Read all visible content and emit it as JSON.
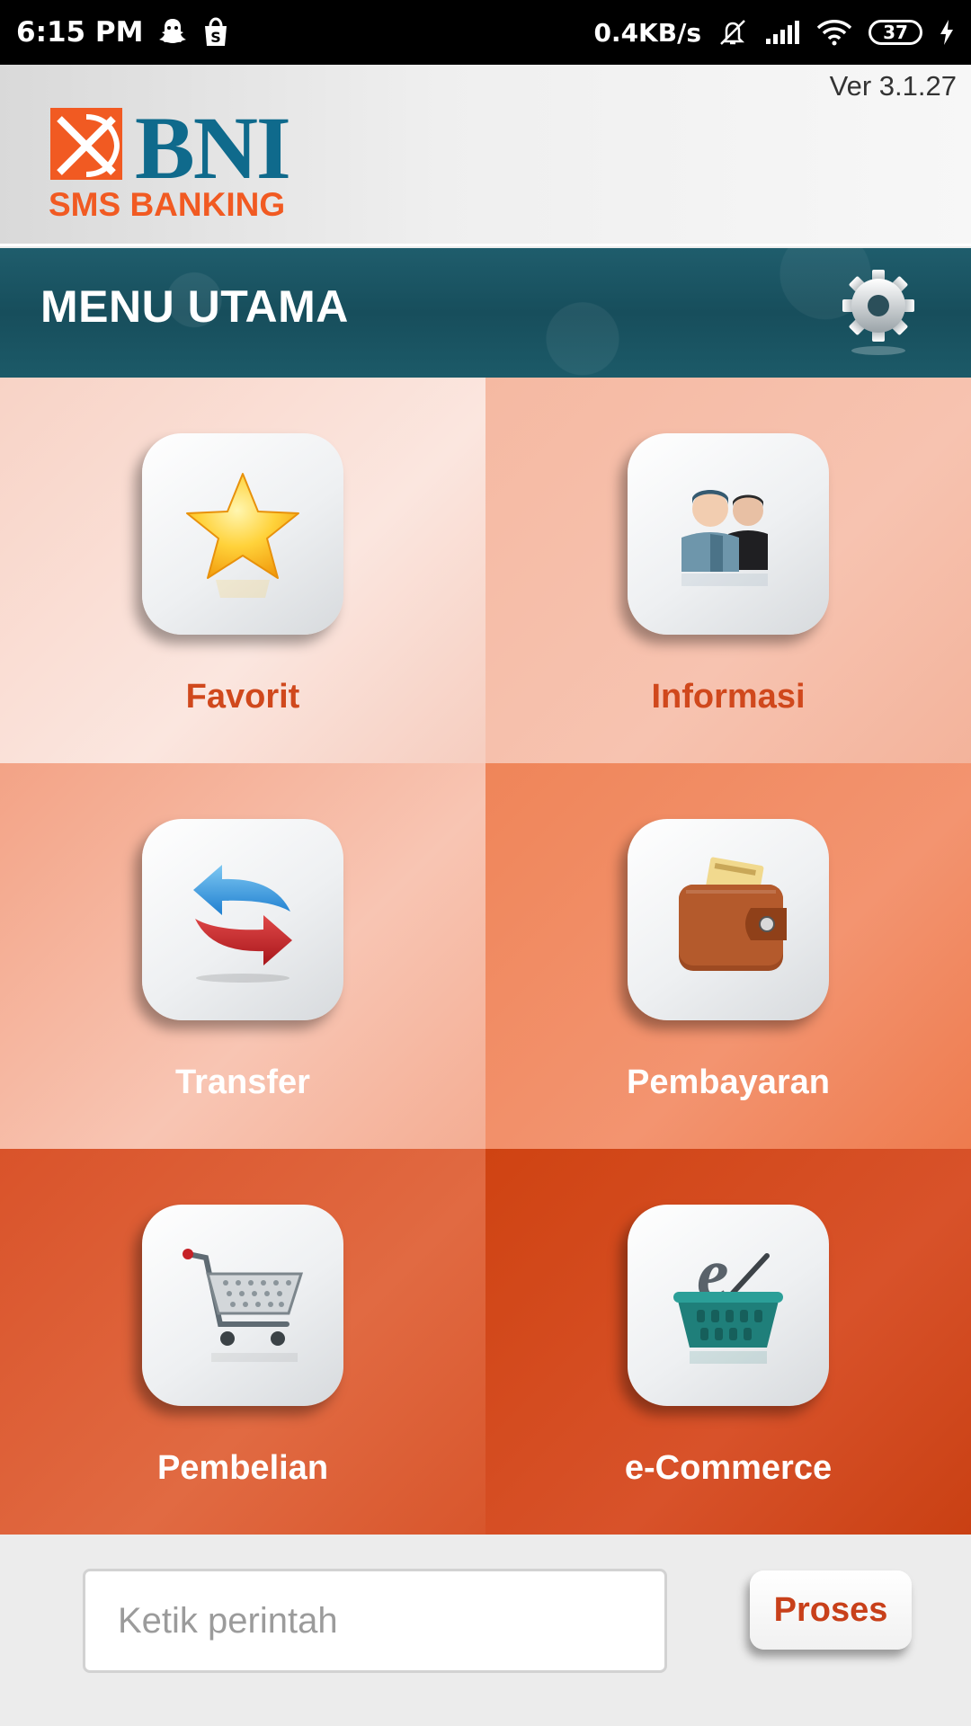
{
  "status_bar": {
    "time": "6:15 PM",
    "network_speed": "0.4KB/s",
    "battery": "37",
    "icons": [
      "snapchat-icon",
      "shopee-bag-icon",
      "mute-icon",
      "signal-icon",
      "wifi-icon",
      "battery-icon",
      "charging-icon"
    ]
  },
  "header": {
    "version": "Ver 3.1.27",
    "logo_brand": "BNI",
    "logo_sub": "SMS BANKING",
    "brand_colors": {
      "blue": "#0f6a8c",
      "orange": "#f15a22"
    }
  },
  "menu": {
    "title": "MENU UTAMA",
    "settings_icon": "gear-icon",
    "items": [
      {
        "label": "Favorit",
        "icon": "star-icon"
      },
      {
        "label": "Informasi",
        "icon": "people-icon"
      },
      {
        "label": "Transfer",
        "icon": "transfer-arrows-icon"
      },
      {
        "label": "Pembayaran",
        "icon": "wallet-icon"
      },
      {
        "label": "Pembelian",
        "icon": "shopping-cart-icon"
      },
      {
        "label": "e-Commerce",
        "icon": "ecommerce-basket-icon"
      }
    ]
  },
  "command": {
    "placeholder": "Ketik perintah",
    "value": "",
    "submit_label": "Proses"
  }
}
